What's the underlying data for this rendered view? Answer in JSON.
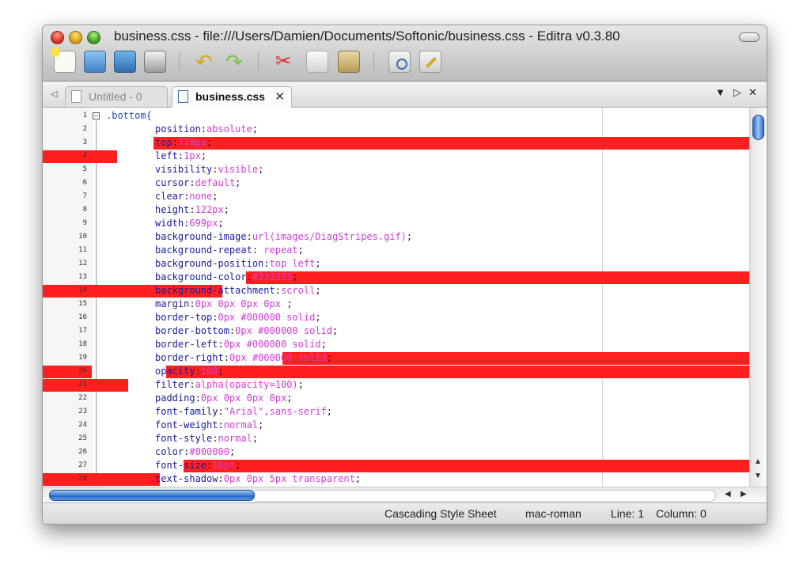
{
  "window": {
    "title": "business.css - file:///Users/Damien/Documents/Softonic/business.css - Editra v0.3.80"
  },
  "toolbar": {
    "icons": [
      "new-file-icon",
      "open-folder-icon",
      "save-icon",
      "print-icon",
      "undo-icon",
      "redo-icon",
      "cut-icon",
      "copy-icon",
      "paste-icon",
      "find-icon",
      "preferences-icon"
    ]
  },
  "tabs": [
    {
      "label": "Untitled - 0",
      "close": ""
    },
    {
      "label": "business.css",
      "close": "✕"
    }
  ],
  "tabbar_controls": {
    "menu": "▼",
    "next": "▷",
    "close": "✕",
    "prev": "◁"
  },
  "editor": {
    "fold_marker": "−",
    "lines": [
      {
        "n": "1",
        "sel": ".bottom{",
        "prop": "",
        "punc": "",
        "val": "",
        "end": ""
      },
      {
        "n": "2",
        "sel": "",
        "prop": "position",
        "punc": ":",
        "val": "absolute",
        "end": ";"
      },
      {
        "n": "3",
        "sel": "",
        "prop": "top",
        "punc": ":",
        "val": "778px",
        "end": ";"
      },
      {
        "n": "4",
        "sel": "",
        "prop": "left",
        "punc": ":",
        "val": "1px",
        "end": ";"
      },
      {
        "n": "5",
        "sel": "",
        "prop": "visibility",
        "punc": ":",
        "val": "visible",
        "end": ";"
      },
      {
        "n": "6",
        "sel": "",
        "prop": "cursor",
        "punc": ":",
        "val": "default",
        "end": ";"
      },
      {
        "n": "7",
        "sel": "",
        "prop": "clear",
        "punc": ":",
        "val": "none",
        "end": ";"
      },
      {
        "n": "8",
        "sel": "",
        "prop": "height",
        "punc": ":",
        "val": "122px",
        "end": ";"
      },
      {
        "n": "9",
        "sel": "",
        "prop": "width",
        "punc": ":",
        "val": "699px",
        "end": ";"
      },
      {
        "n": "10",
        "sel": "",
        "prop": "background-image",
        "punc": ":",
        "val": "url(images/DiagStripes.gif)",
        "end": ";"
      },
      {
        "n": "11",
        "sel": "",
        "prop": "background-repeat",
        "punc": ": ",
        "val": "repeat",
        "end": ";"
      },
      {
        "n": "12",
        "sel": "",
        "prop": "background-position",
        "punc": ":",
        "val": "top left",
        "end": ";"
      },
      {
        "n": "13",
        "sel": "",
        "prop": "background-color",
        "punc": ":",
        "val": "#333333",
        "end": ";"
      },
      {
        "n": "14",
        "sel": "",
        "prop": "background-attachment",
        "punc": ":",
        "val": "scroll",
        "end": ";"
      },
      {
        "n": "15",
        "sel": "",
        "prop": "margin",
        "punc": ":",
        "val": "0px 0px 0px 0px",
        "end": " ;"
      },
      {
        "n": "16",
        "sel": "",
        "prop": "border-top",
        "punc": ":",
        "val": "0px #000000 solid",
        "end": ";"
      },
      {
        "n": "17",
        "sel": "",
        "prop": "border-bottom",
        "punc": ":",
        "val": "0px #000000 solid",
        "end": ";"
      },
      {
        "n": "18",
        "sel": "",
        "prop": "border-left",
        "punc": ":",
        "val": "0px #000000 solid",
        "end": ";"
      },
      {
        "n": "19",
        "sel": "",
        "prop": "border-right",
        "punc": ":",
        "val": "0px #000000 solid",
        "end": ";"
      },
      {
        "n": "20",
        "sel": "",
        "prop": "opacity",
        "punc": ":",
        "val": "100",
        "end": ";"
      },
      {
        "n": "21",
        "sel": "",
        "prop": "filter",
        "punc": ":",
        "val": "alpha(opacity=100)",
        "end": ";"
      },
      {
        "n": "22",
        "sel": "",
        "prop": "padding",
        "punc": ":",
        "val": "0px 0px 0px 0px",
        "end": ";"
      },
      {
        "n": "23",
        "sel": "",
        "prop": "font-family",
        "punc": ":",
        "val": "\"Arial\",sans-serif",
        "end": ";"
      },
      {
        "n": "24",
        "sel": "",
        "prop": "font-weight",
        "punc": ":",
        "val": "normal",
        "end": ";"
      },
      {
        "n": "25",
        "sel": "",
        "prop": "font-style",
        "punc": ":",
        "val": "normal",
        "end": ";"
      },
      {
        "n": "26",
        "sel": "",
        "prop": "color",
        "punc": ":",
        "val": "#000000",
        "end": ";"
      },
      {
        "n": "27",
        "sel": "",
        "prop": "font-size",
        "punc": ":",
        "val": "10pt",
        "end": ";"
      },
      {
        "n": "28",
        "sel": "",
        "prop": "text-shadow",
        "punc": ":",
        "val": "0px 0px 5px transparent",
        "end": ";"
      }
    ]
  },
  "status": {
    "filetype": "Cascading Style Sheet",
    "encoding": "mac-roman",
    "line": "Line: 1",
    "column": "Column: 0"
  },
  "colors": {
    "error_highlight": "#ff1f1f",
    "property": "#1a1a9a",
    "value": "#d23bd8",
    "selector": "#1f4bb8"
  }
}
